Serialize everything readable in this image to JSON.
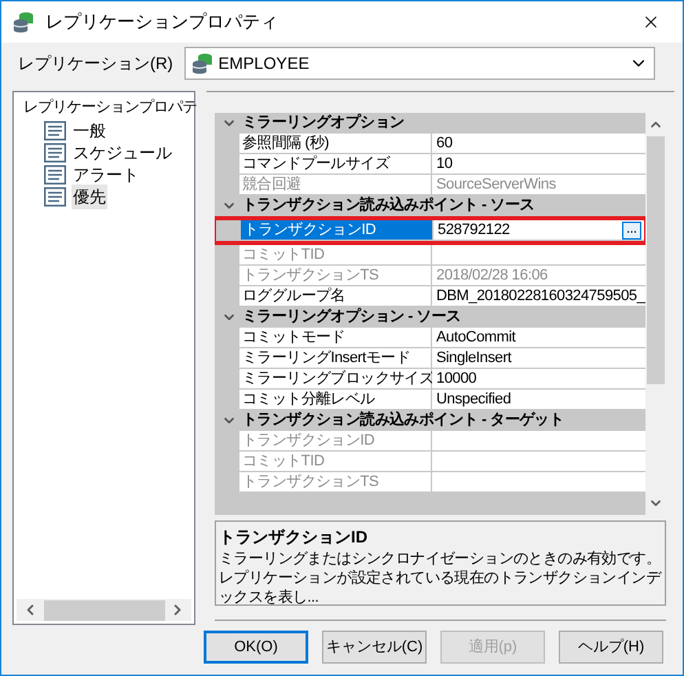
{
  "window": {
    "title": "レプリケーションプロパティ"
  },
  "replication": {
    "label": "レプリケーション(R)",
    "value": "EMPLOYEE"
  },
  "tree": {
    "label": "レプリケーションプロパテ",
    "children": [
      {
        "label": "一般",
        "selected": false
      },
      {
        "label": "スケジュール",
        "selected": false
      },
      {
        "label": "アラート",
        "selected": false
      },
      {
        "label": "優先",
        "selected": true
      }
    ]
  },
  "property_grid": {
    "categories": [
      {
        "title": "ミラーリングオプション",
        "expanded": true,
        "rows": [
          {
            "name": "参照間隔 (秒)",
            "value": "60",
            "disabled": false,
            "selected": false
          },
          {
            "name": "コマンドプールサイズ",
            "value": "10",
            "disabled": false,
            "selected": false
          },
          {
            "name": "競合回避",
            "value": "SourceServerWins",
            "disabled": true,
            "selected": false
          }
        ]
      },
      {
        "title": "トランザクション読み込みポイント - ソース",
        "expanded": true,
        "rows": [
          {
            "name": "トランザクションID",
            "value": "528792122",
            "disabled": false,
            "selected": true
          },
          {
            "name": "コミットTID",
            "value": "",
            "disabled": true,
            "selected": false
          },
          {
            "name": "トランザクションTS",
            "value": "2018/02/28 16:06",
            "disabled": true,
            "selected": false
          },
          {
            "name": "ロググループ名",
            "value": "DBM_20180228160324759505_",
            "disabled": false,
            "selected": false
          }
        ]
      },
      {
        "title": "ミラーリングオプション - ソース",
        "expanded": true,
        "rows": [
          {
            "name": "コミットモード",
            "value": "AutoCommit",
            "disabled": false,
            "selected": false
          },
          {
            "name": "ミラーリングInsertモード",
            "value": "SingleInsert",
            "disabled": false,
            "selected": false
          },
          {
            "name": "ミラーリングブロックサイズ",
            "value": "10000",
            "disabled": false,
            "selected": false
          },
          {
            "name": "コミット分離レベル",
            "value": "Unspecified",
            "disabled": false,
            "selected": false
          }
        ]
      },
      {
        "title": "トランザクション読み込みポイント - ターゲット",
        "expanded": true,
        "rows": [
          {
            "name": "トランザクションID",
            "value": "",
            "disabled": true,
            "selected": false
          },
          {
            "name": "コミットTID",
            "value": "",
            "disabled": true,
            "selected": false
          },
          {
            "name": "トランザクションTS",
            "value": "",
            "disabled": true,
            "selected": false
          }
        ]
      }
    ],
    "ellipsis_button": "..."
  },
  "description": {
    "title": "トランザクションID",
    "text": "ミラーリングまたはシンクロナイゼーションのときのみ有効です。レプリケーションが設定されている現在のトランザクションインデックスを表し..."
  },
  "buttons": [
    {
      "label": "OK(O)",
      "default": true,
      "disabled": false
    },
    {
      "label": "キャンセル(C)",
      "default": false,
      "disabled": false
    },
    {
      "label": "適用(p)",
      "default": false,
      "disabled": true
    },
    {
      "label": "ヘルプ(H)",
      "default": false,
      "disabled": false
    }
  ]
}
